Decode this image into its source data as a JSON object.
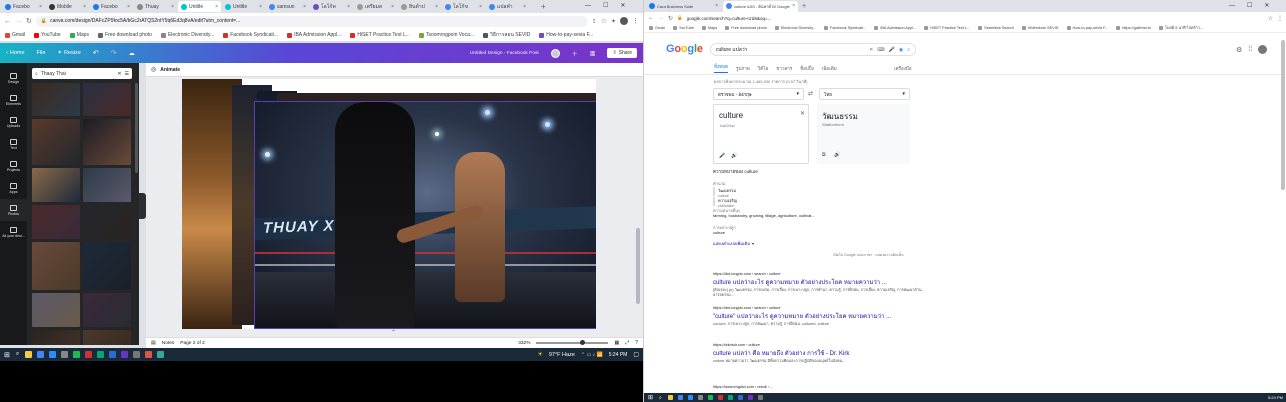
{
  "left": {
    "tabs": [
      {
        "label": "Facebo",
        "color": "#1877f2"
      },
      {
        "label": "Mobile",
        "color": "#333"
      },
      {
        "label": "Facebo",
        "color": "#1877f2"
      },
      {
        "label": "Thuay",
        "color": "#888"
      },
      {
        "label": "Untitle",
        "color": "#00c4cc"
      },
      {
        "label": "Untitle",
        "color": "#00c4cc"
      },
      {
        "label": "samsun",
        "color": "#4285f4"
      },
      {
        "label": "โลโก้ค",
        "color": "#6b4fbb"
      },
      {
        "label": "เตรียมส",
        "color": "#999"
      },
      {
        "label": "สินค้าป",
        "color": "#999"
      },
      {
        "label": "โลโก้ข",
        "color": "#4285f4"
      },
      {
        "label": "แปลคำ",
        "color": "#4285f4"
      }
    ],
    "url": "canva.com/design/DAFcZP9Ioc5A/bGc2rATQS2ntY9q6Ed3q8vA/edit?utm_content=...",
    "bookmarks": [
      {
        "label": "Gmail",
        "color": "#ea4335"
      },
      {
        "label": "YouTube",
        "color": "#ff0000"
      },
      {
        "label": "Maps",
        "color": "#34a853"
      },
      {
        "label": "Free download photo",
        "color": "#666"
      },
      {
        "label": "Electronic Diversity...",
        "color": "#888"
      },
      {
        "label": "Facebook Syndicati...",
        "color": "#d93025"
      },
      {
        "label": "IBA Admission Appl...",
        "color": "#d93025"
      },
      {
        "label": "HiSET Practice Test L...",
        "color": "#d93025"
      },
      {
        "label": "Tsoomrngpoin Voca...",
        "color": "#7a3"
      },
      {
        "label": "วิธีการสอน SEVID",
        "color": "#555"
      },
      {
        "label": "How-to-pay-sevia F...",
        "color": "#6b4fbb"
      }
    ],
    "canva_menu": {
      "home": "Home",
      "file": "File",
      "resize": "Resize",
      "doc_title": "Untitled Design - Facebook Post",
      "share": "Share"
    },
    "rail": [
      "Design",
      "Elements",
      "Uploads",
      "Text",
      "Projects",
      "Apps",
      "Photos",
      "All your desi..."
    ],
    "search": {
      "value": "Thaay Thai"
    },
    "animate": "Animate",
    "notes": "Notes",
    "page_info": "Page 2 of 2",
    "zoom": "332%",
    "banner_text": "THUAY X"
  },
  "left_taskbar": {
    "weather": "97°F Haze",
    "time": "5:24 PM"
  },
  "right": {
    "tabs": [
      {
        "label": "Cara Business Suite",
        "color": "#1877f2"
      },
      {
        "label": "culture แปล - ค้นหาด้วย Google",
        "color": "#4285f4"
      }
    ],
    "url": "google.com/search?q=culture+แปล&oq=...",
    "bookmarks": [
      "Gmail",
      "YouTube",
      "Maps",
      "Free download photo",
      "Electronic Diversity...",
      "Facebook Syndicati...",
      "IBA Admission Appl...",
      "HiSET Practice Test L...",
      "Seamless Search",
      "Nhiêmkum SEVID",
      "How-to-pay-sevia F...",
      "https://gallerist.to",
      "โพสต์ 5 นาที ไปคร้าว..."
    ],
    "query": "culture แปลว่า",
    "search_tabs": [
      "ทั้งหมด",
      "รูปภาพ",
      "วิดีโอ",
      "ข่าวสาร",
      "ช็อปปิ้ง",
      "เพิ่มเติม"
    ],
    "tools": "เครื่องมือ",
    "stats": "ผลการค้นหาประมาณ 1,460,000 รายการ (0.57 วินาที)",
    "src_lang": "ตรวจพบ - อังกฤษ",
    "tgt_lang": "ไทย",
    "src_text": "culture",
    "src_phonetic": "ˈkəlCHər",
    "tgt_text": "วัฒนธรรม",
    "tgt_phonetic": "Wạtthnṭhrrm",
    "defs_header": "ความหมายของ culture",
    "pos": "คำนาม",
    "defs": [
      {
        "term": "วัฒนธรรม",
        "sub": "culture"
      },
      {
        "term": "ความเจริญ",
        "sub": "civilization"
      }
    ],
    "def_more_label": "ความหมายอื่นๆ",
    "def_more": "farming, husbandry, growing, tillage, agriculture, cultivat...",
    "pos2": "การเพาะปลูก",
    "pos2_sub": "culture",
    "show_more": "แสดงคำแปลเพิ่มเติม",
    "feedback": "เปิดใน Google แปลภาษา · แสดงความคิดเห็น",
    "results": [
      {
        "url": "https://dict.longdo.com › search › culture",
        "title": "culture แปลว่าอะไร ดูความหมาย ตัวอย่างประโยค หมายความว่า ...",
        "snippet": "[คัลเจอะ] (n) วัฒนธรรม, การอบรม, การเลี้ยง, การเพาะปลูก, การทำนา, ความรู้, การฝึกฝน, การเลี้ยง, ความเจริญ, การพัฒนาด้าน, อารยธรรม..."
      },
      {
        "url": "https://dict.longdo.com › search › culture",
        "title": "\"culture\" แปลว่าอะไร ดูความหมาย ตัวอย่างประโยค หมายความว่า ...",
        "snippet": "cul-ture, การเพาะปลูก, การพัฒนา, ความรู้, การฝึกฝน, cultured, cutlure"
      },
      {
        "url": "https://drkrisdr.com › culture",
        "title": "culture แปลว่า คือ หมายถึง ตัวอย่าง การใช้ - Dr. Kirk",
        "snippet": "culture หมายความว่า วัฒนธรรม มีทั้งความคิดและการปฏิบัติของมนุษย์ในสังคม..."
      },
      {
        "url": "https://www.engdict.com › result › ...",
        "title": "",
        "snippet": ""
      }
    ]
  },
  "right_taskbar": {
    "time": "5:24 PM"
  },
  "colors": {
    "canva_purple": "#6b34c8",
    "canva_dark": "#18191b",
    "taskbar": "#1b2a38"
  }
}
